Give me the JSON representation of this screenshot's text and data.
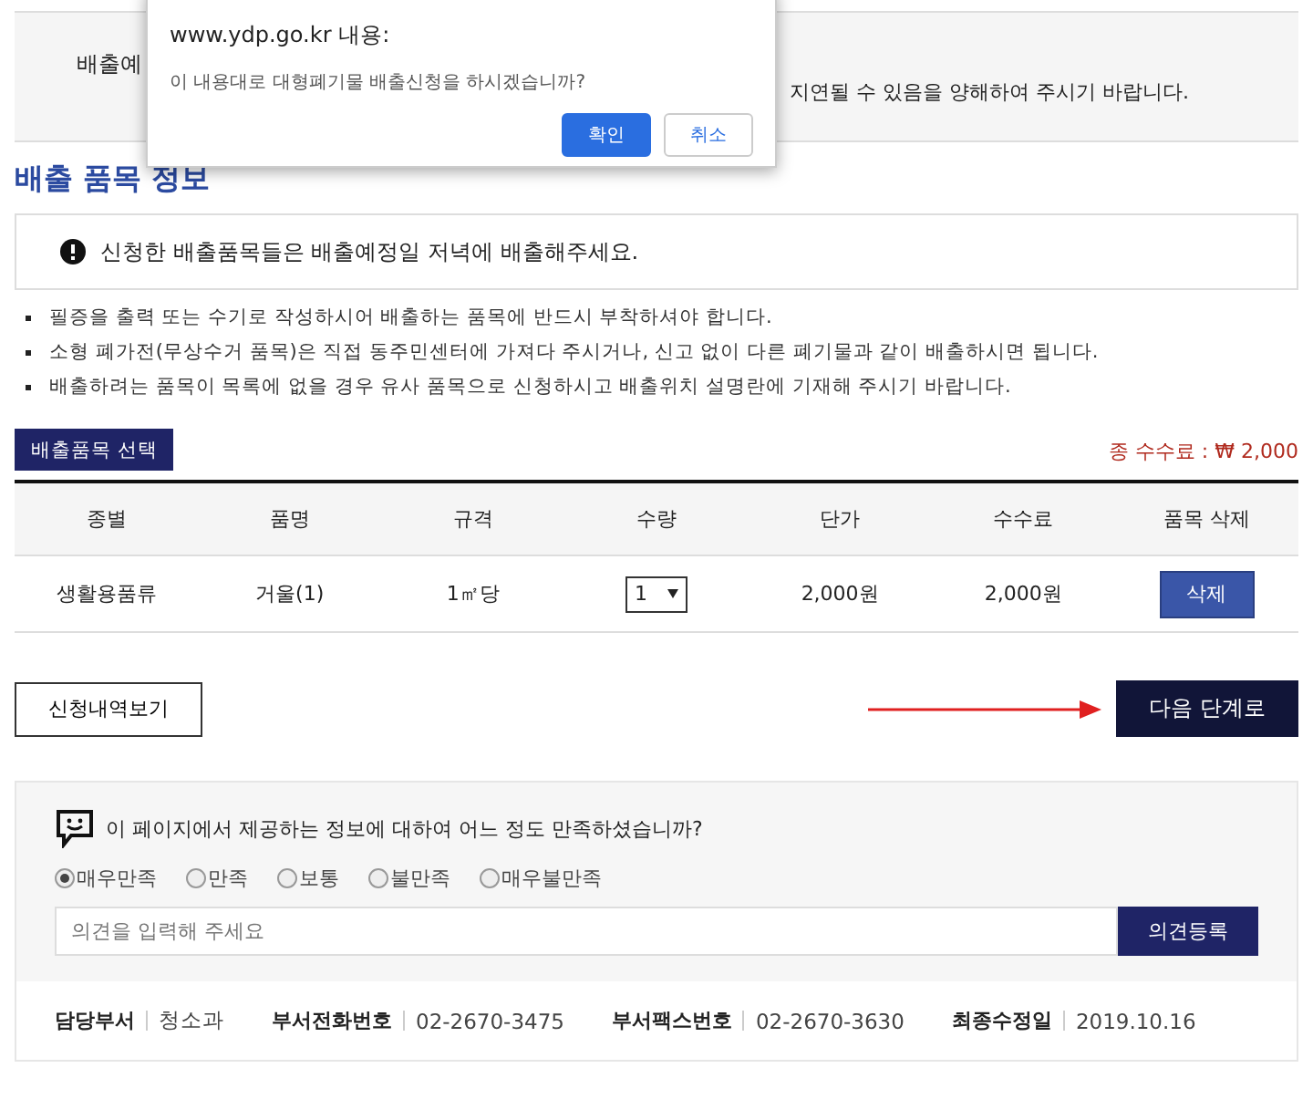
{
  "top_panel": {
    "label": "배출예",
    "note": "지연될 수 있음을 양해하여 주시기 바랍니다."
  },
  "dialog": {
    "title": "www.ydp.go.kr 내용:",
    "message": "이 내용대로 대형폐기물 배출신청을 하시겠습니까?",
    "buttons": [
      {
        "label": "확인",
        "kind": "primary"
      },
      {
        "label": "취소",
        "kind": "secondary"
      }
    ]
  },
  "section_title": "배출 품목 정보",
  "notice": "신청한 배출품목들은 배출예정일 저녁에 배출해주세요.",
  "bullets": [
    "필증을 출력 또는 수기로 작성하시어 배출하는 품목에 반드시 부착하셔야 합니다.",
    "소형 폐가전(무상수거 품목)은 직접 동주민센터에 가져다 주시거나, 신고 없이 다른 폐기물과 같이 배출하시면 됩니다.",
    "배출하려는 품목이 목록에 없을 경우 유사 품목으로 신청하시고 배출위치 설명란에 기재해 주시기 바랍니다."
  ],
  "select_button": "배출품목 선택",
  "total_fee": "종 수수료 : ₩ 2,000",
  "table": {
    "columns": [
      "종별",
      "품명",
      "규격",
      "수량",
      "단가",
      "수수료",
      "품목 삭제"
    ],
    "rows": [
      {
        "cells": [
          "생활용품류",
          "거울(1)",
          "1㎡당",
          "1",
          "2,000원",
          "2,000원",
          "삭제"
        ]
      }
    ]
  },
  "history_button": "신청내역보기",
  "next_button": "다음 단계로",
  "feedback": {
    "question": "이 페이지에서 제공하는 정보에 대하여 어느 정도 만족하셨습니까?",
    "options": [
      {
        "label": "매우만족",
        "selected": true
      },
      {
        "label": "만족",
        "selected": false
      },
      {
        "label": "보통",
        "selected": false
      },
      {
        "label": "불만족",
        "selected": false
      },
      {
        "label": "매우불만족",
        "selected": false
      }
    ],
    "placeholder": "의견을 입력해 주세요",
    "submit": "의견등록"
  },
  "footer": [
    {
      "label": "담당부서",
      "value": "청소과"
    },
    {
      "label": "부서전화번호",
      "value": "02-2670-3475"
    },
    {
      "label": "부서팩스번호",
      "value": "02-2670-3630"
    },
    {
      "label": "최종수정일",
      "value": "2019.10.16"
    }
  ]
}
